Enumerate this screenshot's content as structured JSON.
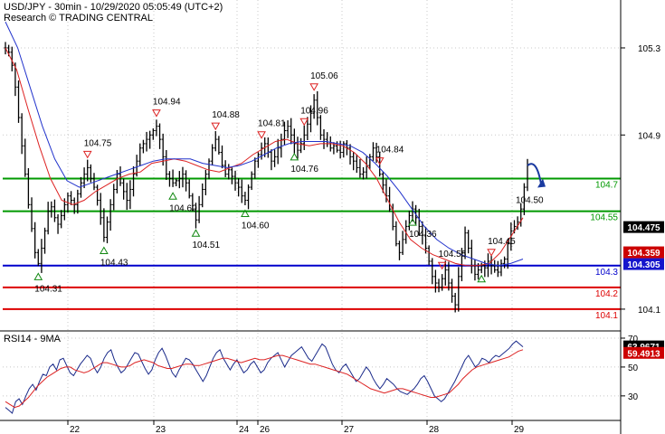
{
  "header": {
    "line1": "USD/JPY - 30min - 10/29/2020 05:05:49 (UTC+2)",
    "line2": "Research © TRADING CENTRAL"
  },
  "colors": {
    "support": "#009900",
    "resistance": "#0000cc",
    "red_line": "#dd0000",
    "price": "#000000",
    "ema_red": "#dd2222",
    "ema_blue": "#2233cc",
    "arrow": "#1a3aa0",
    "tri_down": "#dd2222",
    "tri_up": "#118811",
    "badge_black": "#000000",
    "badge_red": "#cc0000",
    "badge_blue": "#1515cc"
  },
  "chart_data": [
    {
      "type": "line",
      "title": "",
      "y_ticks": [
        104.1,
        104.9,
        105.3
      ],
      "ylim": [
        104.0,
        105.52
      ],
      "x_ticks": [
        "22",
        "23",
        "24",
        "26",
        "27",
        "28",
        "29"
      ],
      "series": [
        {
          "values": [
            105.3,
            105.28,
            105.22,
            105.12,
            104.98,
            104.85,
            104.72,
            104.58,
            104.47,
            104.36,
            104.31,
            104.38,
            104.46,
            104.55,
            104.57,
            104.52,
            104.49,
            104.53,
            104.58,
            104.62,
            104.6,
            104.58,
            104.63,
            104.68,
            104.72,
            104.75,
            104.7,
            104.66,
            104.6,
            104.52,
            104.43,
            104.5,
            104.58,
            104.65,
            104.72,
            104.68,
            104.64,
            104.6,
            104.65,
            104.72,
            104.78,
            104.84,
            104.86,
            104.88,
            104.9,
            104.92,
            104.94,
            104.88,
            104.8,
            104.72,
            104.7,
            104.68,
            104.69,
            104.7,
            104.72,
            104.68,
            104.62,
            104.56,
            104.51,
            104.58,
            104.65,
            104.72,
            104.78,
            104.84,
            104.88,
            104.82,
            104.76,
            104.72,
            104.74,
            104.71,
            104.68,
            104.66,
            104.62,
            104.6,
            104.66,
            104.72,
            104.78,
            104.81,
            104.84,
            104.86,
            104.82,
            104.78,
            104.8,
            104.84,
            104.88,
            104.92,
            104.94,
            104.9,
            104.86,
            104.83,
            104.86,
            104.9,
            104.95,
            105.0,
            105.06,
            104.98,
            104.9,
            104.88,
            104.86,
            104.84,
            104.85,
            104.83,
            104.82,
            104.86,
            104.84,
            104.8,
            104.78,
            104.75,
            104.72,
            104.73,
            104.76,
            104.8,
            104.84,
            104.8,
            104.72,
            104.67,
            104.62,
            104.56,
            104.48,
            104.4,
            104.36,
            104.42,
            104.48,
            104.53,
            104.56,
            104.52,
            104.48,
            104.44,
            104.38,
            104.32,
            104.25,
            104.22,
            104.2,
            104.24,
            104.28,
            104.22,
            104.16,
            104.12,
            104.25,
            104.36,
            104.45,
            104.38,
            104.3,
            104.26,
            104.28,
            104.3,
            104.29,
            104.32,
            104.3,
            104.28,
            104.27,
            104.31,
            104.33,
            104.4,
            104.46,
            104.48,
            104.5,
            104.56,
            104.66,
            104.76
          ]
        },
        {
          "name": "EMA red",
          "values": [
            105.3,
            105.2,
            105.02,
            104.85,
            104.7,
            104.6,
            104.58,
            104.6,
            104.64,
            104.67,
            104.7,
            104.72,
            104.73,
            104.77,
            104.78,
            104.79,
            104.78,
            104.76,
            104.74,
            104.73,
            104.75,
            104.77,
            104.81,
            104.84,
            104.87,
            104.88,
            104.86,
            104.85,
            104.86,
            104.86,
            104.85,
            104.82,
            104.77,
            104.7,
            104.6,
            104.5,
            104.42,
            104.38,
            104.35,
            104.33,
            104.31,
            104.3,
            104.3,
            104.31,
            104.36,
            104.44,
            104.52
          ]
        },
        {
          "name": "EMA blue",
          "values": [
            105.42,
            105.3,
            105.12,
            104.94,
            104.79,
            104.69,
            104.66,
            104.68,
            104.7,
            104.72,
            104.74,
            104.76,
            104.78,
            104.79,
            104.79,
            104.79,
            104.77,
            104.76,
            104.75,
            104.76,
            104.78,
            104.81,
            104.84,
            104.86,
            104.87,
            104.87,
            104.87,
            104.86,
            104.85,
            104.82,
            104.77,
            104.71,
            104.64,
            104.56,
            104.48,
            104.42,
            104.38,
            104.35,
            104.33,
            104.31,
            104.3,
            104.31,
            104.33
          ]
        }
      ],
      "levels": [
        {
          "value": 104.7,
          "label": "104.7",
          "color": "#009900"
        },
        {
          "value": 104.55,
          "label": "104.55",
          "color": "#009900"
        },
        {
          "value": 104.3,
          "label": "104.3",
          "color": "#0000cc"
        },
        {
          "value": 104.2,
          "label": "104.2",
          "color": "#dd0000"
        },
        {
          "value": 104.1,
          "label": "104.1",
          "color": "#dd0000"
        }
      ],
      "annotations": [
        {
          "label": "104.75",
          "i": 25,
          "dir": "down"
        },
        {
          "label": "104.94",
          "i": 46,
          "dir": "down"
        },
        {
          "label": "104.88",
          "i": 64,
          "dir": "down"
        },
        {
          "label": "104.81",
          "i": 78,
          "dir": "down"
        },
        {
          "label": "104.96",
          "i": 91,
          "dir": "down"
        },
        {
          "label": "105.06",
          "i": 94,
          "dir": "down"
        },
        {
          "label": "104.84",
          "i": 114,
          "dir": "down"
        },
        {
          "label": "104.56",
          "i": 133,
          "dir": "down"
        },
        {
          "label": "104.45",
          "i": 148,
          "dir": "down"
        },
        {
          "label": "104.31",
          "i": 10,
          "dir": "up"
        },
        {
          "label": "104.43",
          "i": 30,
          "dir": "up"
        },
        {
          "label": "104.60",
          "i": 51,
          "dir": "up"
        },
        {
          "label": "104.51",
          "i": 58,
          "dir": "up"
        },
        {
          "label": "104.60",
          "i": 73,
          "dir": "up"
        },
        {
          "label": "104.76",
          "i": 88,
          "dir": "up"
        },
        {
          "label": "104.36",
          "i": 124,
          "dir": "up"
        },
        {
          "label": "",
          "i": 145,
          "dir": "up"
        }
      ],
      "forecast_label": "104.50",
      "forecast_target": 104.7,
      "badges": [
        {
          "text": "104.475",
          "value": 104.475,
          "color": "#000000"
        },
        {
          "text": "104.359",
          "value": 104.359,
          "color": "#cc0000"
        },
        {
          "text": "104.305",
          "value": 104.305,
          "color": "#1515cc"
        }
      ]
    },
    {
      "type": "line",
      "title": "RSI14 - 9MA",
      "y_ticks": [
        30,
        50,
        70
      ],
      "ylim": [
        13,
        75
      ],
      "series": [
        {
          "name": "RSI14",
          "values": [
            22,
            20,
            18,
            26,
            28,
            24,
            30,
            35,
            38,
            34,
            40,
            45,
            44,
            50,
            52,
            48,
            55,
            56,
            51,
            46,
            44,
            48,
            52,
            55,
            58,
            56,
            50,
            46,
            50,
            56,
            60,
            62,
            55,
            50,
            46,
            48,
            52,
            56,
            60,
            59,
            54,
            49,
            45,
            48,
            55,
            60,
            63,
            58,
            52,
            46,
            43,
            48,
            52,
            56,
            55,
            52,
            48,
            44,
            40,
            44,
            50,
            56,
            60,
            62,
            56,
            52,
            48,
            52,
            55,
            50,
            46,
            48,
            52,
            54,
            50,
            46,
            48,
            53,
            56,
            58,
            60,
            55,
            50,
            54,
            58,
            60,
            62,
            64,
            60,
            56,
            54,
            58,
            62,
            66,
            64,
            58,
            52,
            48,
            46,
            50,
            52,
            48,
            44,
            40,
            42,
            46,
            50,
            47,
            42,
            38,
            35,
            38,
            42,
            40,
            38,
            35,
            33,
            32,
            31,
            33,
            35,
            38,
            42,
            44,
            40,
            35,
            30,
            28,
            26,
            28,
            32,
            36,
            40,
            45,
            50,
            55,
            58,
            54,
            50,
            52,
            56,
            55,
            53,
            56,
            58,
            57,
            59,
            61,
            63,
            66,
            68,
            66,
            64
          ]
        },
        {
          "name": "9MA",
          "values": [
            26,
            24,
            22,
            23,
            26,
            29,
            33,
            37,
            40,
            43,
            45,
            47,
            49,
            50,
            50,
            48,
            47,
            46,
            47,
            49,
            51,
            53,
            53,
            52,
            51,
            50,
            50,
            51,
            53,
            54,
            55,
            54,
            53,
            51,
            50,
            49,
            49,
            50,
            51,
            52,
            52,
            51,
            51,
            52,
            53,
            54,
            55,
            56,
            56,
            55,
            54,
            53,
            54,
            55,
            56,
            55,
            55,
            56,
            57,
            58,
            58,
            57,
            56,
            55,
            54,
            53,
            52,
            52,
            51,
            50,
            49,
            48,
            47,
            46,
            45,
            43,
            41,
            39,
            37,
            35,
            34,
            33,
            32,
            33,
            34,
            35,
            35,
            34,
            33,
            32,
            31,
            30,
            29,
            29,
            30,
            31,
            32,
            35,
            38,
            42,
            45,
            48,
            50,
            51,
            52,
            53,
            54,
            55,
            56,
            57,
            59,
            61,
            62
          ]
        }
      ],
      "badges": [
        {
          "text": "63.9671",
          "value": 63.9671,
          "color": "#000000"
        },
        {
          "text": "59.4913",
          "value": 59.4913,
          "color": "#cc0000"
        }
      ]
    }
  ]
}
